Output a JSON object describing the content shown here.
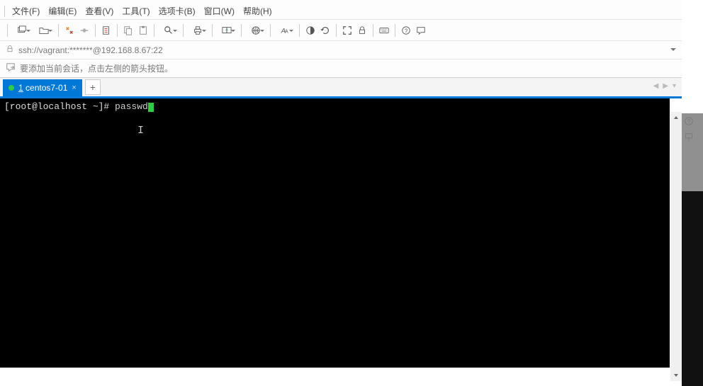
{
  "menubar": {
    "file": "文件(F)",
    "edit": "编辑(E)",
    "view": "查看(V)",
    "tools": "工具(T)",
    "tabs": "选项卡(B)",
    "window": "窗口(W)",
    "help": "帮助(H)"
  },
  "addressbar": {
    "url": "ssh://vagrant:*******@192.168.8.67:22"
  },
  "tipbar": {
    "text": "要添加当前会话，点击左侧的箭头按钮。"
  },
  "tabs": {
    "active_num": "1",
    "active_label": " centos7-01",
    "newtab": "+",
    "close": "×",
    "nav_left": "◀",
    "nav_right": "▶",
    "nav_down": "▾"
  },
  "terminal": {
    "prompt": "[root@localhost ~]# ",
    "command": "passwd"
  }
}
